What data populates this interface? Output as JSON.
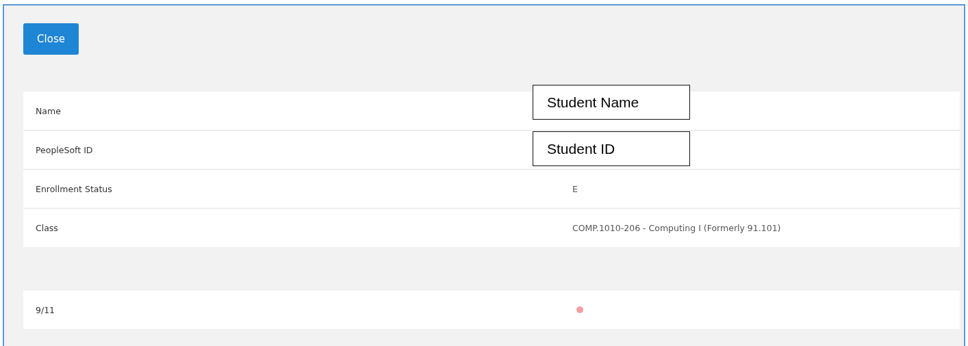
{
  "close_button": {
    "label": "Close"
  },
  "details": [
    {
      "label": "Name",
      "annotation": "Student Name"
    },
    {
      "label": "PeopleSoft ID",
      "annotation": "Student ID"
    },
    {
      "label": "Enrollment Status",
      "value": "E"
    },
    {
      "label": "Class",
      "value": "COMP.1010-206 - Computing I (Formerly 91.101)"
    }
  ],
  "attendance": [
    {
      "date": "9/11",
      "color": "#f4a0a0"
    }
  ]
}
